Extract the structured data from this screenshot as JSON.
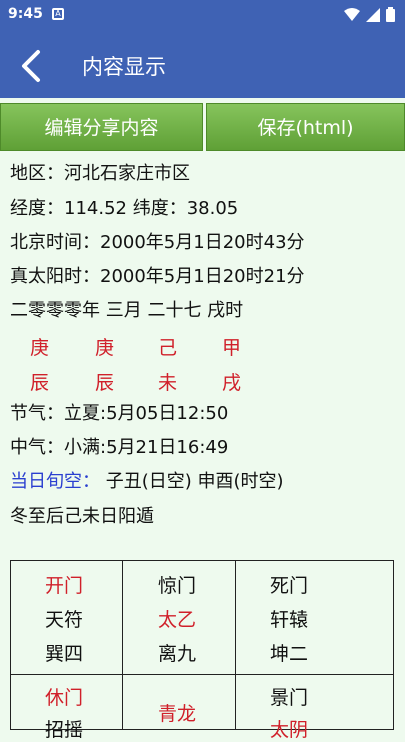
{
  "status": {
    "time": "9:45",
    "notif_letter": "A"
  },
  "app_bar": {
    "title": "内容显示"
  },
  "buttons": {
    "edit_share": "编辑分享内容",
    "save_html": "保存(html)"
  },
  "info": {
    "region": "地区：河北石家庄市区",
    "coords": "经度：114.52 纬度：38.05",
    "beijing_time": "北京时间：2000年5月1日20时43分",
    "solar_time": "真太阳时：2000年5月1日20时21分",
    "lunar_date": "二零零零年 三月 二十七 戌时",
    "solar_term": "节气：立夏:5月05日12:50",
    "mid_term": "中气：小满:5月21日16:49",
    "void_label": "当日旬空：",
    "void_value": " 子丑(日空)   申酉(时空)",
    "dun": "冬至后己未日阳遁"
  },
  "stems": [
    "庚",
    "庚",
    "己",
    "甲"
  ],
  "branches": [
    "辰",
    "辰",
    "未",
    "戌"
  ],
  "palace": {
    "r1c1": [
      "开门",
      "天符",
      "巽四"
    ],
    "r1c2": [
      "惊门",
      "太乙",
      "离九"
    ],
    "r1c3": [
      "死门",
      "轩辕",
      "坤二"
    ],
    "r2c1": [
      "休门",
      "招摇"
    ],
    "r2c2": [
      "青龙"
    ],
    "r2c3": [
      "景门",
      "太阴"
    ]
  },
  "colors": {
    "accent": "#3f62b4",
    "button": "#6eb246",
    "ink_red": "#d0202a",
    "ink_blue": "#2a3fd0",
    "background": "#eefaee"
  }
}
